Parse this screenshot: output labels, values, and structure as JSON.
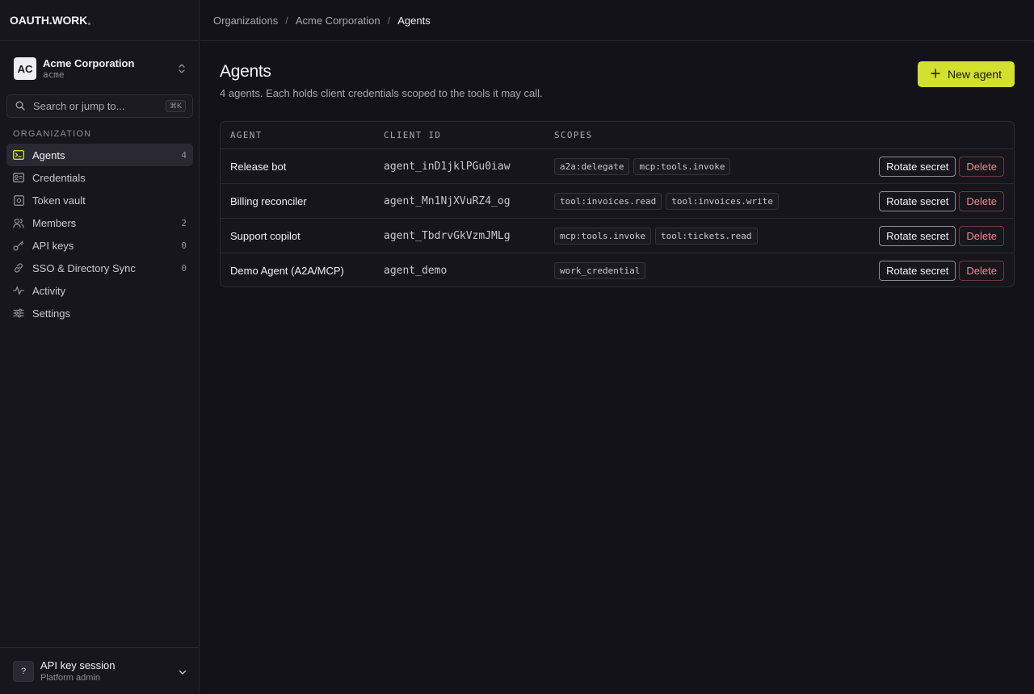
{
  "brand": "OAUTH.WORK",
  "org": {
    "initials": "AC",
    "name": "Acme Corporation",
    "slug": "acme"
  },
  "search": {
    "placeholder": "Search or jump to...",
    "shortcut": "⌘K"
  },
  "sidebar": {
    "section_label": "ORGANIZATION",
    "items": [
      {
        "label": "Agents",
        "count": "4",
        "icon": "terminal-icon",
        "active": true
      },
      {
        "label": "Credentials",
        "count": "",
        "icon": "id-card-icon"
      },
      {
        "label": "Token vault",
        "count": "",
        "icon": "vault-icon"
      },
      {
        "label": "Members",
        "count": "2",
        "icon": "users-icon"
      },
      {
        "label": "API keys",
        "count": "0",
        "icon": "key-icon"
      },
      {
        "label": "SSO & Directory Sync",
        "count": "0",
        "icon": "link-icon"
      },
      {
        "label": "Activity",
        "count": "",
        "icon": "activity-icon"
      },
      {
        "label": "Settings",
        "count": "",
        "icon": "sliders-icon"
      }
    ]
  },
  "session": {
    "initial": "?",
    "title": "API key session",
    "subtitle": "Platform admin"
  },
  "breadcrumb": [
    "Organizations",
    "Acme Corporation",
    "Agents"
  ],
  "page": {
    "title": "Agents",
    "subtitle": "4 agents. Each holds client credentials scoped to the tools it may call.",
    "new_button": "New agent"
  },
  "table": {
    "headers": [
      "AGENT",
      "CLIENT ID",
      "SCOPES"
    ],
    "rotate_label": "Rotate secret",
    "delete_label": "Delete",
    "rows": [
      {
        "name": "Release bot",
        "client_id": "agent_inD1jklPGu0iaw",
        "scopes": [
          "a2a:delegate",
          "mcp:tools.invoke"
        ]
      },
      {
        "name": "Billing reconciler",
        "client_id": "agent_Mn1NjXVuRZ4_og",
        "scopes": [
          "tool:invoices.read",
          "tool:invoices.write"
        ]
      },
      {
        "name": "Support copilot",
        "client_id": "agent_TbdrvGkVzmJMLg",
        "scopes": [
          "mcp:tools.invoke",
          "tool:tickets.read"
        ]
      },
      {
        "name": "Demo Agent (A2A/MCP)",
        "client_id": "agent_demo",
        "scopes": [
          "work_credential"
        ]
      }
    ]
  },
  "colors": {
    "accent": "#d4e02e",
    "danger": "#f08a8a",
    "background": "#131219"
  }
}
